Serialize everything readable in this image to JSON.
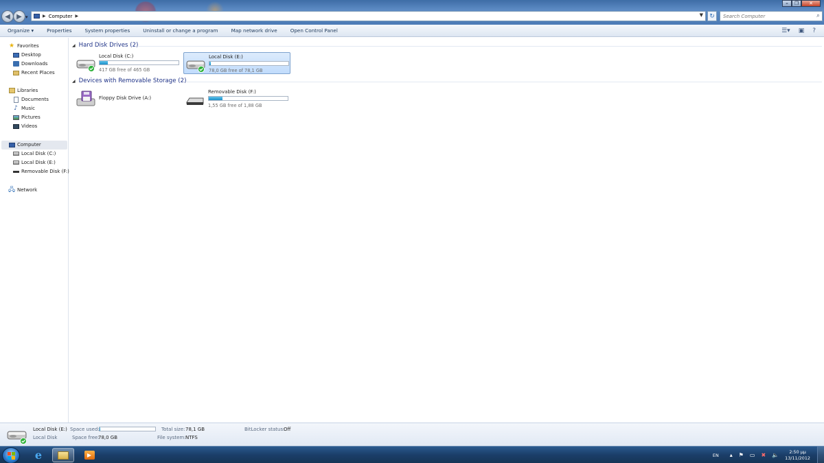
{
  "window": {
    "search_placeholder": "Search Computer",
    "breadcrumb": [
      "Computer"
    ]
  },
  "toolbar": {
    "organize": "Organize",
    "properties": "Properties",
    "system_properties": "System properties",
    "uninstall": "Uninstall or change a program",
    "map_drive": "Map network drive",
    "control_panel": "Open Control Panel"
  },
  "sidebar": {
    "favorites": "Favorites",
    "desktop": "Desktop",
    "downloads": "Downloads",
    "recent_places": "Recent Places",
    "libraries": "Libraries",
    "documents": "Documents",
    "music": "Music",
    "pictures": "Pictures",
    "videos": "Videos",
    "computer": "Computer",
    "local_c": "Local Disk (C:)",
    "local_e": "Local Disk (E:)",
    "removable_f": "Removable Disk (F:)",
    "network": "Network"
  },
  "groups": {
    "hard_disks": "Hard Disk Drives (2)",
    "removable": "Devices with Removable Storage (2)"
  },
  "drives": {
    "c": {
      "name": "Local Disk (C:)",
      "free_text": "417 GB free of 465 GB",
      "used_fraction": 0.103
    },
    "e": {
      "name": "Local Disk (E:)",
      "free_text": "78,0 GB free of 78,1 GB",
      "used_fraction": 0.002
    },
    "a": {
      "name": "Floppy Disk Drive (A:)"
    },
    "f": {
      "name": "Removable Disk (F:)",
      "free_text": "1,55 GB free of 1,88 GB",
      "used_fraction": 0.176
    }
  },
  "details": {
    "name": "Local Disk (E:)",
    "type": "Local Disk",
    "space_used_label": "Space used:",
    "space_free_label": "Space free:",
    "space_free_value": "78,0 GB",
    "total_size_label": "Total size:",
    "total_size_value": "78,1 GB",
    "file_system_label": "File system:",
    "file_system_value": "NTFS",
    "bitlocker_label": "BitLocker status:",
    "bitlocker_value": "Off"
  },
  "taskbar": {
    "language": "EN",
    "time": "2:50 μμ",
    "date": "13/11/2012"
  },
  "colors": {
    "accent": "#1e3287",
    "bar_fill": "#1b8fc9",
    "selection": "#c1dcfc"
  }
}
